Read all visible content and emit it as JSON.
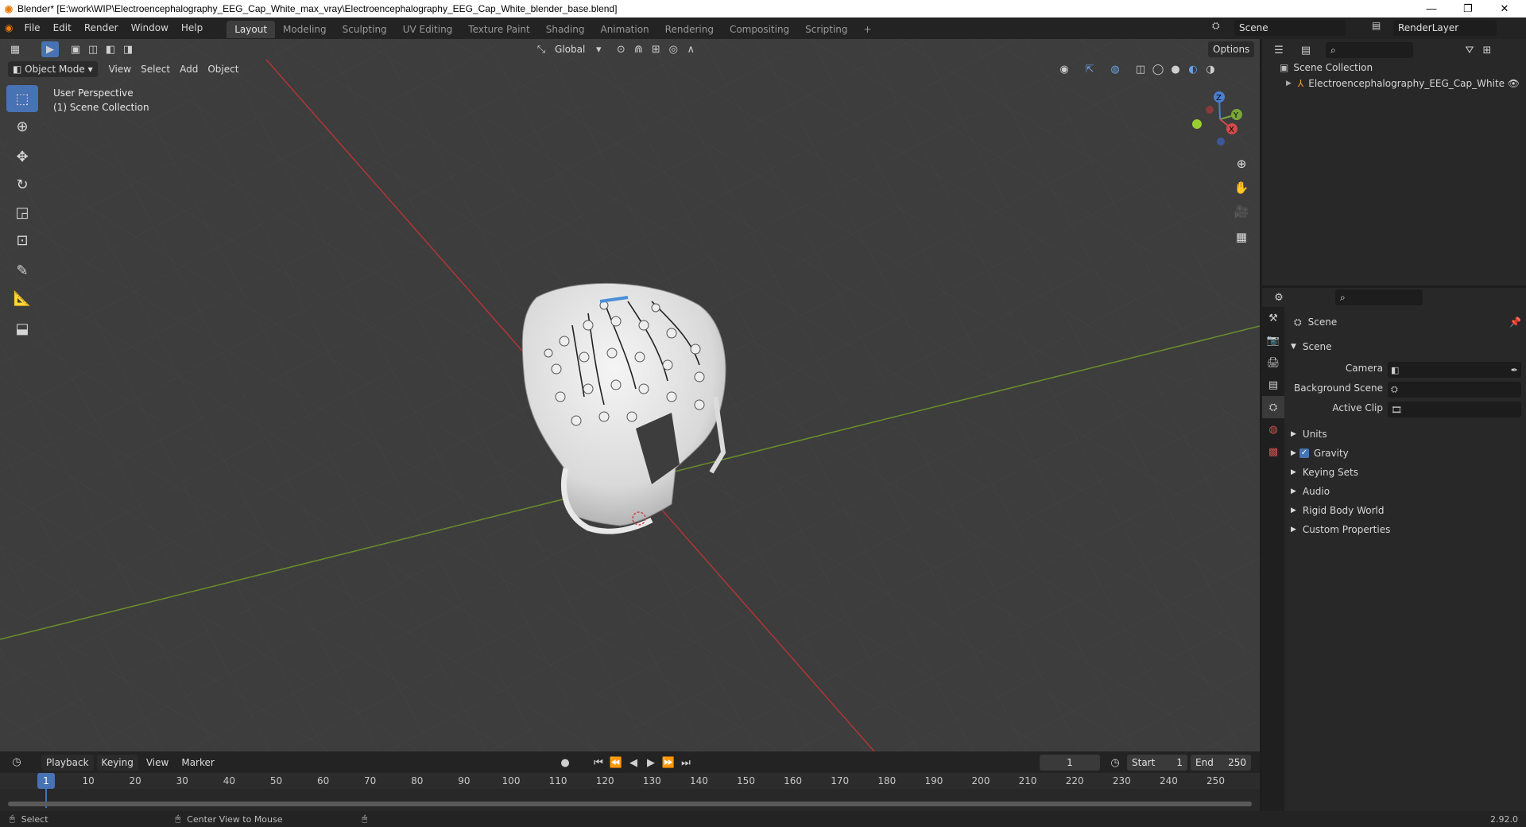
{
  "window": {
    "title": "Blender* [E:\\work\\WIP\\Electroencephalography_EEG_Cap_White_max_vray\\Electroencephalography_EEG_Cap_White_blender_base.blend]",
    "minimize": "—",
    "restore": "❐",
    "close": "✕"
  },
  "menu": [
    "File",
    "Edit",
    "Render",
    "Window",
    "Help"
  ],
  "workspaces": [
    "Layout",
    "Modeling",
    "Sculpting",
    "UV Editing",
    "Texture Paint",
    "Shading",
    "Animation",
    "Rendering",
    "Compositing",
    "Scripting"
  ],
  "add_workspace": "+",
  "scene_field": "Scene",
  "renderlayer_field": "RenderLayer",
  "viewport": {
    "mode": "Object Mode",
    "menus": [
      "View",
      "Select",
      "Add",
      "Object"
    ],
    "transform_orientation": "Global",
    "options": "Options",
    "perspective_label": "User Perspective",
    "collection_label": "(1) Scene Collection",
    "gizmo": {
      "x": "X",
      "y": "Y",
      "z": "Z"
    }
  },
  "outliner": {
    "root": "Scene Collection",
    "items": [
      "Electroencephalography_EEG_Cap_White"
    ]
  },
  "properties": {
    "header": "Scene",
    "panel": "Scene",
    "fields": [
      {
        "label": "Camera",
        "value": ""
      },
      {
        "label": "Background Scene",
        "value": ""
      },
      {
        "label": "Active Clip",
        "value": ""
      }
    ],
    "subpanels": [
      "Units",
      "Gravity",
      "Keying Sets",
      "Audio",
      "Rigid Body World",
      "Custom Properties"
    ],
    "gravity_checked": true
  },
  "timeline": {
    "menus": [
      "Playback",
      "Keying",
      "View",
      "Marker"
    ],
    "current_frame": "1",
    "start_label": "Start",
    "start": "1",
    "end_label": "End",
    "end": "250",
    "ticks": [
      "1",
      "10",
      "20",
      "30",
      "40",
      "50",
      "60",
      "70",
      "80",
      "90",
      "100",
      "110",
      "120",
      "130",
      "140",
      "150",
      "160",
      "170",
      "180",
      "190",
      "200",
      "210",
      "220",
      "230",
      "240",
      "250"
    ]
  },
  "statusbar": {
    "select": "Select",
    "center_view": "Center View to Mouse",
    "version": "2.92.0"
  },
  "colors": {
    "accent": "#4772b3",
    "x_axis": "#c43a3a",
    "y_axis": "#6f9a2a",
    "viewport_bg": "#3d3d3d"
  }
}
